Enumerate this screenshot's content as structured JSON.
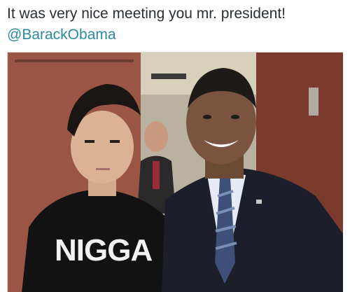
{
  "tweet": {
    "text": "It was very nice meeting you mr. president!",
    "mention": "@BarackObama"
  },
  "photo": {
    "shirt_text": "NIGGA"
  },
  "colors": {
    "text": "#292f33",
    "mention": "#2b8aa0"
  }
}
